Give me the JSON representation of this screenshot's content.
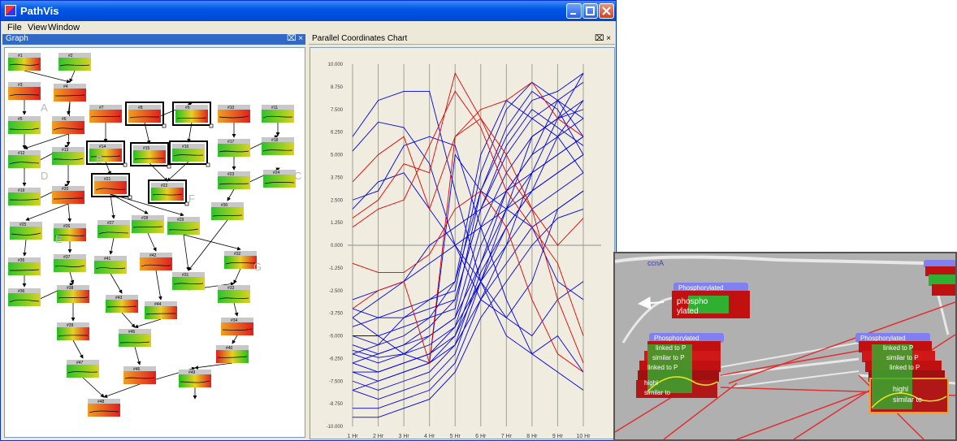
{
  "app": {
    "title": "PathVis",
    "icon": "pathvis-app-icon"
  },
  "menu": {
    "items": [
      "File",
      "View",
      "Window"
    ]
  },
  "panels": {
    "graph": {
      "title": "Graph",
      "pin": "⌧ ×"
    },
    "chart": {
      "title": "Parallel Coordinates Chart",
      "pin": "⌧ ×"
    }
  },
  "colors": {
    "accent": "#3169c6",
    "series_a": "#0000e0",
    "series_b": "#e00000"
  },
  "graph_labels": [
    {
      "id": "A",
      "text": "A"
    },
    {
      "id": "B",
      "text": "B"
    },
    {
      "id": "C",
      "text": "C"
    },
    {
      "id": "D",
      "text": "D"
    },
    {
      "id": "E",
      "text": "E"
    },
    {
      "id": "F",
      "text": "F"
    },
    {
      "id": "G",
      "text": "G"
    }
  ],
  "nodes": [
    {
      "id": "#1"
    },
    {
      "id": "#2"
    },
    {
      "id": "#3"
    },
    {
      "id": "#4"
    },
    {
      "id": "#5"
    },
    {
      "id": "#6"
    },
    {
      "id": "#7"
    },
    {
      "id": "#8"
    },
    {
      "id": "#9"
    },
    {
      "id": "#10"
    },
    {
      "id": "#11"
    },
    {
      "id": "#12"
    },
    {
      "id": "#13"
    },
    {
      "id": "#14"
    },
    {
      "id": "#15"
    },
    {
      "id": "#16"
    },
    {
      "id": "#17"
    },
    {
      "id": "#18"
    },
    {
      "id": "#19"
    },
    {
      "id": "#20"
    },
    {
      "id": "#21"
    },
    {
      "id": "#22"
    },
    {
      "id": "#23"
    },
    {
      "id": "#24"
    },
    {
      "id": "#25"
    },
    {
      "id": "#26"
    },
    {
      "id": "#27"
    },
    {
      "id": "#28"
    },
    {
      "id": "#29"
    },
    {
      "id": "#30"
    },
    {
      "id": "#31"
    },
    {
      "id": "#32"
    },
    {
      "id": "#33"
    },
    {
      "id": "#34"
    },
    {
      "id": "#35"
    },
    {
      "id": "#36"
    },
    {
      "id": "#37"
    },
    {
      "id": "#38"
    },
    {
      "id": "#39"
    },
    {
      "id": "#40"
    },
    {
      "id": "#41"
    },
    {
      "id": "#42"
    },
    {
      "id": "#43"
    },
    {
      "id": "#44"
    },
    {
      "id": "#45"
    },
    {
      "id": "#46"
    },
    {
      "id": "#47"
    },
    {
      "id": "#48"
    },
    {
      "id": "#49"
    }
  ],
  "chart_data": {
    "type": "line",
    "categories": [
      "1 Hr",
      "2 Hr",
      "3 Hr",
      "4 Hr",
      "5 Hr",
      "6 Hr",
      "7 Hr",
      "8 Hr",
      "9 Hr",
      "10 Hr"
    ],
    "yticks": [
      "10.000",
      "8.750",
      "7.500",
      "6.250",
      "5.000",
      "3.750",
      "2.500",
      "1.250",
      "0.000",
      "-1.250",
      "-2.500",
      "-3.750",
      "-5.000",
      "-6.250",
      "-7.500",
      "-8.750",
      "-10.000"
    ],
    "ylim": [
      -10,
      10
    ],
    "series": [
      {
        "color": "blue",
        "values": [
          6,
          8,
          8.5,
          8.5,
          3,
          -2,
          -5,
          -6,
          -5,
          -7
        ]
      },
      {
        "color": "blue",
        "values": [
          5.2,
          6.8,
          6.5,
          4.5,
          0,
          -3,
          -4,
          -2,
          2,
          3
        ]
      },
      {
        "color": "blue",
        "values": [
          2.5,
          3,
          5.5,
          6,
          5.5,
          1,
          -3,
          -6,
          -7,
          -8
        ]
      },
      {
        "color": "blue",
        "values": [
          2,
          3.5,
          4,
          2,
          0,
          -2,
          -4,
          -5,
          -3,
          -2
        ]
      },
      {
        "color": "blue",
        "values": [
          -4,
          -5,
          -6,
          -6.5,
          5,
          3,
          2,
          1,
          -2,
          -3
        ]
      },
      {
        "color": "blue",
        "values": [
          -5,
          -5.5,
          -5,
          -4,
          -2,
          3,
          6,
          8,
          8.5,
          9.5
        ]
      },
      {
        "color": "blue",
        "values": [
          -5.5,
          -6,
          -5.5,
          -4.5,
          -3,
          2,
          5,
          7,
          8,
          9
        ]
      },
      {
        "color": "blue",
        "values": [
          -6,
          -6.5,
          -6,
          -5,
          -4,
          1,
          4,
          6,
          7,
          8
        ]
      },
      {
        "color": "blue",
        "values": [
          -6.5,
          -7,
          -6.5,
          -6,
          -4.5,
          0,
          3,
          5,
          6,
          7
        ]
      },
      {
        "color": "blue",
        "values": [
          -7,
          -7.5,
          -7,
          -6.5,
          -5,
          -1,
          2,
          4,
          5,
          6
        ]
      },
      {
        "color": "blue",
        "values": [
          -7.5,
          -8,
          -7.5,
          -7,
          -5.5,
          -1.5,
          1,
          3,
          4,
          5
        ]
      },
      {
        "color": "blue",
        "values": [
          -8,
          -8.5,
          -8,
          -7.5,
          -6,
          -2,
          0,
          2,
          3,
          4
        ]
      },
      {
        "color": "blue",
        "values": [
          -9,
          -9,
          -8.5,
          -8,
          -6.5,
          -3,
          -1,
          1,
          2,
          3
        ]
      },
      {
        "color": "blue",
        "values": [
          -9.5,
          -9.5,
          -9,
          -8.5,
          -7,
          -4,
          -2,
          0,
          1.5,
          2
        ]
      },
      {
        "color": "blue",
        "values": [
          -6,
          -5.5,
          -4,
          -3,
          -2.5,
          4,
          7.5,
          9,
          8,
          6
        ]
      },
      {
        "color": "blue",
        "values": [
          -5,
          -5,
          -4.5,
          -4,
          -3.5,
          3,
          6.5,
          8.5,
          7.5,
          5
        ]
      },
      {
        "color": "blue",
        "values": [
          -4.5,
          -4,
          -3.5,
          -3,
          -2,
          5,
          8,
          7,
          6,
          4
        ]
      },
      {
        "color": "blue",
        "values": [
          -3.5,
          -4,
          -4,
          -3.5,
          -3,
          2,
          5.5,
          7.5,
          6.5,
          5.5
        ]
      },
      {
        "color": "blue",
        "values": [
          -6.5,
          -6,
          -5.5,
          -5,
          -4,
          -1,
          3,
          5,
          8,
          7
        ]
      },
      {
        "color": "blue",
        "values": [
          -7,
          -7,
          -6.5,
          -6,
          -5,
          -2,
          1,
          3,
          6,
          8
        ]
      },
      {
        "color": "blue",
        "values": [
          -8,
          -7.5,
          -7,
          -6.5,
          -5.5,
          -3,
          0,
          4,
          7,
          9.5
        ]
      },
      {
        "color": "blue",
        "values": [
          -5.8,
          -6.2,
          -6,
          -5.5,
          -4.5,
          -2,
          2,
          6,
          7,
          7.5
        ]
      },
      {
        "color": "blue",
        "values": [
          -4,
          -3,
          -2,
          0,
          1,
          2,
          3,
          4,
          5,
          6
        ]
      },
      {
        "color": "blue",
        "values": [
          -3,
          -2.5,
          -2,
          -1,
          0,
          1,
          2,
          3,
          4,
          5
        ]
      },
      {
        "color": "red",
        "values": [
          1,
          2,
          2.5,
          5.5,
          8.5,
          6.5,
          3,
          1,
          -1,
          -5
        ]
      },
      {
        "color": "red",
        "values": [
          1.5,
          2.5,
          4.5,
          4,
          9.5,
          7,
          5,
          2,
          0,
          1.5
        ]
      },
      {
        "color": "red",
        "values": [
          3.5,
          5,
          6,
          2,
          6,
          7.5,
          8,
          9,
          7,
          6
        ]
      },
      {
        "color": "red",
        "values": [
          -1,
          -1.5,
          -1.5,
          -0.5,
          2,
          3,
          1,
          -3,
          -6,
          -7
        ]
      },
      {
        "color": "red",
        "values": [
          -3.5,
          -2.5,
          -2,
          -6.5,
          6,
          7,
          4,
          2,
          -3,
          -6.5
        ]
      }
    ]
  },
  "zoom": {
    "top_label": "ccnA",
    "nodes": [
      {
        "header": "Phosphorylated",
        "lines": [
          "phospho",
          "ylated"
        ]
      },
      {
        "header": "Phosphorylated",
        "lines": [
          "linked to P",
          "similar to P",
          "linked to P",
          "highl",
          "similar to"
        ]
      },
      {
        "header": "Phosphorylated",
        "lines": [
          "linked to P",
          "similar to P",
          "linked to P",
          "highl",
          "similar to"
        ]
      }
    ]
  }
}
